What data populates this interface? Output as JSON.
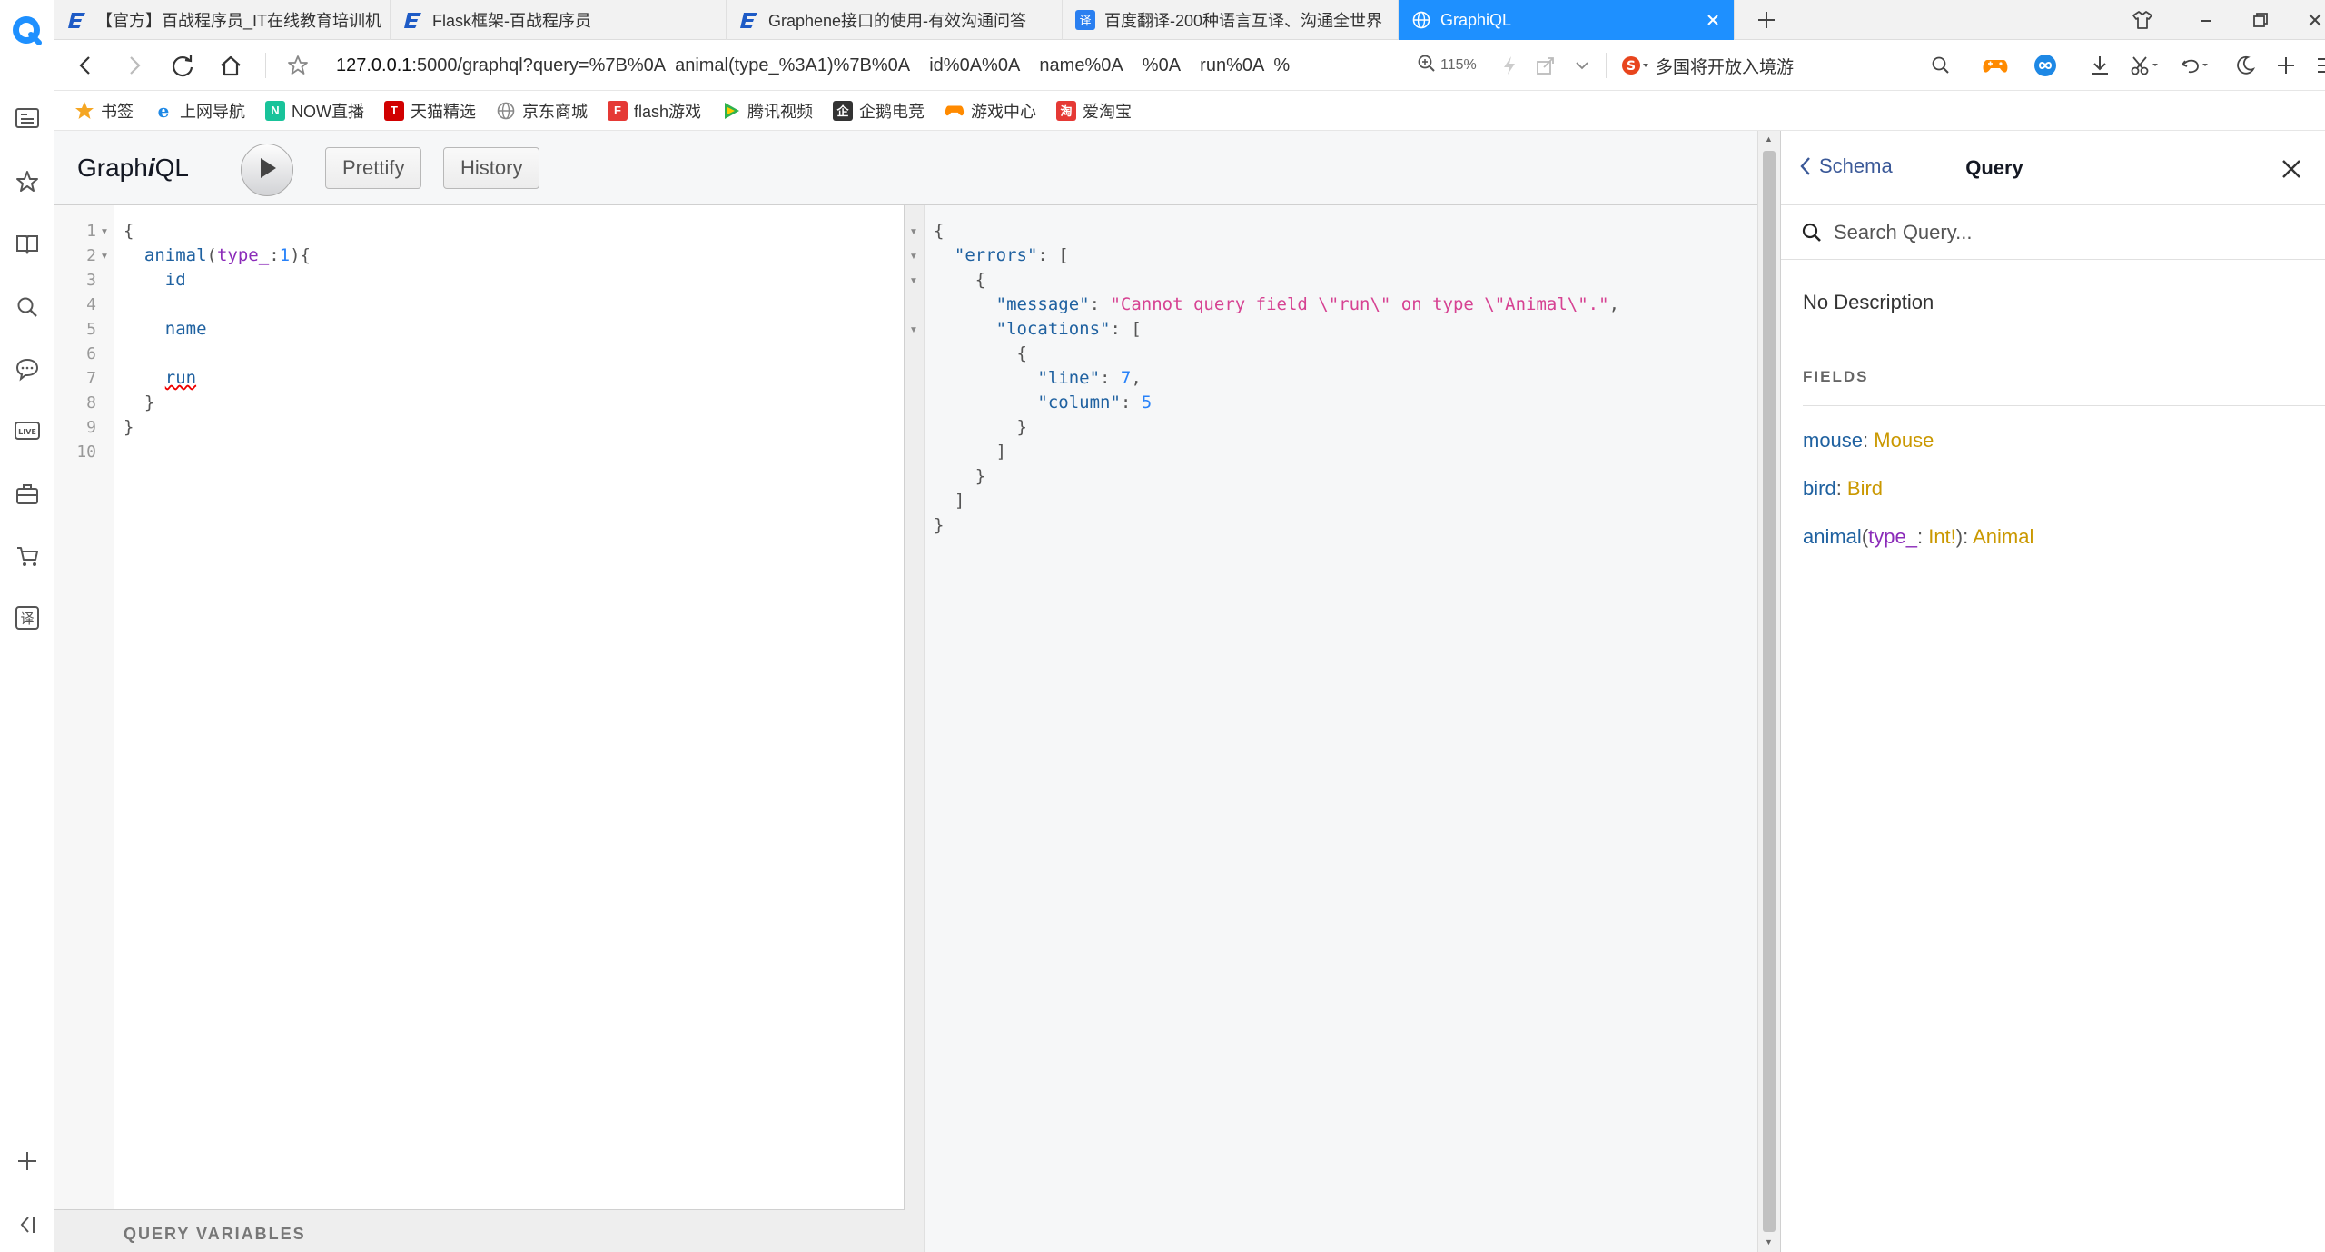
{
  "browser": {
    "tabs": [
      {
        "title": "【官方】百战程序员_IT在线教育培训机",
        "icon": "bz-logo-icon"
      },
      {
        "title": "Flask框架-百战程序员",
        "icon": "bz-logo-icon"
      },
      {
        "title": "Graphene接口的使用-有效沟通问答",
        "icon": "bz-logo-icon"
      },
      {
        "title": "百度翻译-200种语言互译、沟通全世界",
        "icon": "translate-icon"
      },
      {
        "title": "GraphiQL",
        "icon": "globe-icon",
        "active": true
      }
    ],
    "address": {
      "host": "127.0.0.1",
      "rest": ":5000/graphql?query=%7B%0A  animal(type_%3A1)%7B%0A    id%0A%0A    name%0A    %0A    run%0A  %",
      "zoom": "115%",
      "search_text": "多国将开放入境游"
    },
    "bookmarks": [
      {
        "label": "书签",
        "icon": "star-icon",
        "color": "#f5a623"
      },
      {
        "label": "上网导航",
        "icon": "ie-icon",
        "color": "#1e88e5"
      },
      {
        "label": "NOW直播",
        "icon": "now-icon",
        "color": "#19c39a"
      },
      {
        "label": "天猫精选",
        "icon": "tmall-icon",
        "color": "#d10000"
      },
      {
        "label": "京东商城",
        "icon": "globe-icon",
        "color": "#888888"
      },
      {
        "label": "flash游戏",
        "icon": "flash-icon",
        "color": "#e53935"
      },
      {
        "label": "腾讯视频",
        "icon": "tencent-video-icon",
        "color": "#2fb24c"
      },
      {
        "label": "企鹅电竞",
        "icon": "penguin-icon",
        "color": "#333333"
      },
      {
        "label": "游戏中心",
        "icon": "gamepad-icon",
        "color": "#ff8a00"
      },
      {
        "label": "爱淘宝",
        "icon": "taobao-icon",
        "color": "#e53935"
      }
    ]
  },
  "graphiql": {
    "title_pre": "Graph",
    "title_i": "i",
    "title_post": "QL",
    "buttons": {
      "prettify": "Prettify",
      "history": "History"
    },
    "query_lines": [
      "1",
      "2",
      "3",
      "4",
      "5",
      "6",
      "7",
      "8",
      "9",
      "10"
    ],
    "query": {
      "l1": "{",
      "l2_field": "animal",
      "l2_open": "(",
      "l2_arg": "type_",
      "l2_colon": ":",
      "l2_num": "1",
      "l2_close": "){",
      "l3": "id",
      "l5": "name",
      "l7": "run",
      "l8": "}",
      "l9": "}"
    },
    "query_variables_label": "QUERY VARIABLES",
    "result": {
      "open": "{",
      "errors_key": "\"errors\"",
      "bracket_open": "[",
      "obj_open": "{",
      "message_key": "\"message\"",
      "message_val": "\"Cannot query field \\\"run\\\" on type \\\"Animal\\\".\"",
      "locations_key": "\"locations\"",
      "line_key": "\"line\"",
      "line_val": "7",
      "column_key": "\"column\"",
      "column_val": "5",
      "obj_close": "}",
      "bracket_close": "]",
      "close": "}"
    }
  },
  "docs": {
    "back_label": "Schema",
    "title": "Query",
    "search_placeholder": "Search Query...",
    "description": "No Description",
    "fields_heading": "FIELDS",
    "fields": {
      "mouse": {
        "name": "mouse",
        "type": "Mouse"
      },
      "bird": {
        "name": "bird",
        "type": "Bird"
      },
      "animal": {
        "name": "animal",
        "arg": "type_",
        "arg_type": "Int!",
        "type": "Animal"
      }
    }
  },
  "colors": {
    "accent": "#1e90ff",
    "field": "#1f61a0",
    "type": "#ca9800",
    "arg": "#8b2bb9",
    "string": "#d64292",
    "number": "#2882f9"
  }
}
